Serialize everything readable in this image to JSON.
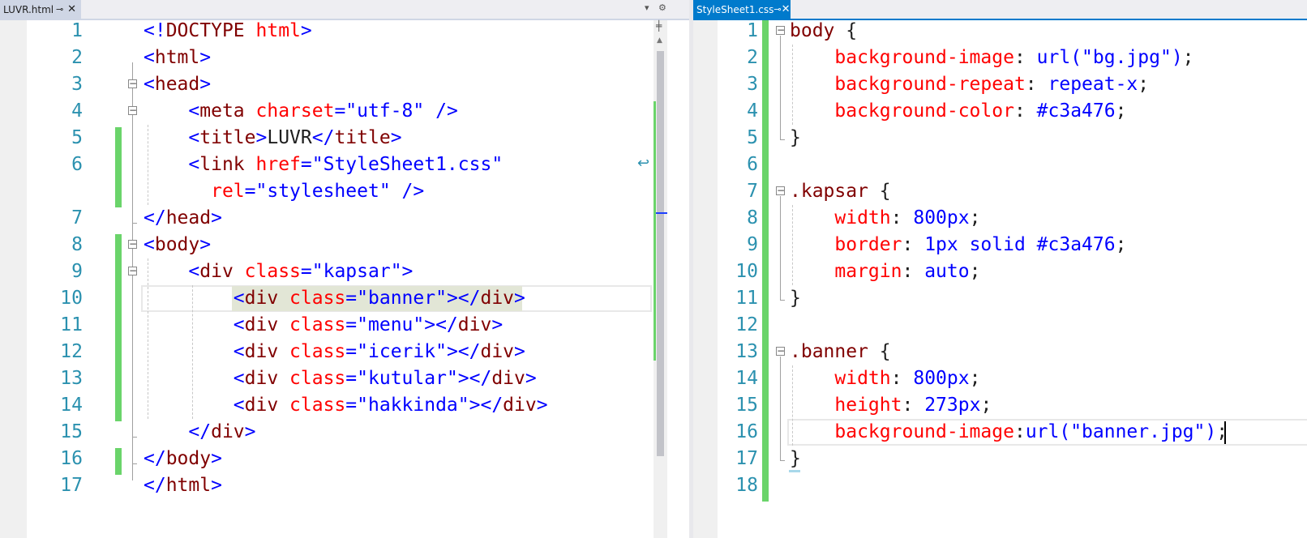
{
  "left_tab": {
    "title": "LUVR.html",
    "pin": "⊸",
    "close": "✕"
  },
  "right_tab": {
    "title": "StyleSheet1.css",
    "pin": "⊸",
    "close": "✕"
  },
  "strip_icons": {
    "dropdown": "▾",
    "settings": "⚙"
  },
  "html_lines": [
    {
      "num": "1",
      "segs": [
        [
          "p",
          "<!"
        ],
        [
          "t",
          "DOCTYPE"
        ],
        [
          "s",
          " "
        ],
        [
          "a",
          "html"
        ],
        [
          "p",
          ">"
        ]
      ]
    },
    {
      "num": "2",
      "segs": [
        [
          "p",
          "<"
        ],
        [
          "t",
          "html"
        ],
        [
          "p",
          ">"
        ]
      ]
    },
    {
      "num": "3",
      "segs": [
        [
          "p",
          "<"
        ],
        [
          "t",
          "head"
        ],
        [
          "p",
          ">"
        ]
      ]
    },
    {
      "num": "4",
      "segs": [
        [
          "s",
          "    "
        ],
        [
          "p",
          "<"
        ],
        [
          "t",
          "meta"
        ],
        [
          "s",
          " "
        ],
        [
          "a",
          "charset"
        ],
        [
          "p",
          "=\""
        ],
        [
          "v",
          "utf-8"
        ],
        [
          "p",
          "\""
        ],
        [
          "s",
          " "
        ],
        [
          "p",
          "/>"
        ]
      ]
    },
    {
      "num": "5",
      "segs": [
        [
          "s",
          "    "
        ],
        [
          "p",
          "<"
        ],
        [
          "t",
          "title"
        ],
        [
          "p",
          ">"
        ],
        [
          "s",
          "LUVR"
        ],
        [
          "p",
          "</"
        ],
        [
          "t",
          "title"
        ],
        [
          "p",
          ">"
        ]
      ]
    },
    {
      "num": "6",
      "segs": [
        [
          "s",
          "    "
        ],
        [
          "p",
          "<"
        ],
        [
          "t",
          "link"
        ],
        [
          "s",
          " "
        ],
        [
          "a",
          "href"
        ],
        [
          "p",
          "=\""
        ],
        [
          "v",
          "StyleSheet1.css"
        ],
        [
          "p",
          "\""
        ]
      ]
    },
    {
      "num": "",
      "segs": [
        [
          "s",
          "      "
        ],
        [
          "a",
          "rel"
        ],
        [
          "p",
          "=\""
        ],
        [
          "v",
          "stylesheet"
        ],
        [
          "p",
          "\""
        ],
        [
          "s",
          " "
        ],
        [
          "p",
          "/>"
        ]
      ]
    },
    {
      "num": "7",
      "segs": [
        [
          "p",
          "</"
        ],
        [
          "t",
          "head"
        ],
        [
          "p",
          ">"
        ]
      ]
    },
    {
      "num": "8",
      "segs": [
        [
          "p",
          "<"
        ],
        [
          "t",
          "body"
        ],
        [
          "p",
          ">"
        ]
      ]
    },
    {
      "num": "9",
      "segs": [
        [
          "s",
          "    "
        ],
        [
          "p",
          "<"
        ],
        [
          "t",
          "div"
        ],
        [
          "s",
          " "
        ],
        [
          "a",
          "class"
        ],
        [
          "p",
          "=\""
        ],
        [
          "v",
          "kapsar"
        ],
        [
          "p",
          "\">"
        ]
      ]
    },
    {
      "num": "10",
      "segs": [
        [
          "s",
          "        "
        ],
        [
          "p",
          "<"
        ],
        [
          "t",
          "div"
        ],
        [
          "s",
          " "
        ],
        [
          "a",
          "class"
        ],
        [
          "p",
          "=\""
        ],
        [
          "v",
          "banner"
        ],
        [
          "p",
          "\"></"
        ],
        [
          "t",
          "div"
        ],
        [
          "p",
          ">"
        ]
      ]
    },
    {
      "num": "11",
      "segs": [
        [
          "s",
          "        "
        ],
        [
          "p",
          "<"
        ],
        [
          "t",
          "div"
        ],
        [
          "s",
          " "
        ],
        [
          "a",
          "class"
        ],
        [
          "p",
          "=\""
        ],
        [
          "v",
          "menu"
        ],
        [
          "p",
          "\"></"
        ],
        [
          "t",
          "div"
        ],
        [
          "p",
          ">"
        ]
      ]
    },
    {
      "num": "12",
      "segs": [
        [
          "s",
          "        "
        ],
        [
          "p",
          "<"
        ],
        [
          "t",
          "div"
        ],
        [
          "s",
          " "
        ],
        [
          "a",
          "class"
        ],
        [
          "p",
          "=\""
        ],
        [
          "v",
          "icerik"
        ],
        [
          "p",
          "\"></"
        ],
        [
          "t",
          "div"
        ],
        [
          "p",
          ">"
        ]
      ]
    },
    {
      "num": "13",
      "segs": [
        [
          "s",
          "        "
        ],
        [
          "p",
          "<"
        ],
        [
          "t",
          "div"
        ],
        [
          "s",
          " "
        ],
        [
          "a",
          "class"
        ],
        [
          "p",
          "=\""
        ],
        [
          "v",
          "kutular"
        ],
        [
          "p",
          "\"></"
        ],
        [
          "t",
          "div"
        ],
        [
          "p",
          ">"
        ]
      ]
    },
    {
      "num": "14",
      "segs": [
        [
          "s",
          "        "
        ],
        [
          "p",
          "<"
        ],
        [
          "t",
          "div"
        ],
        [
          "s",
          " "
        ],
        [
          "a",
          "class"
        ],
        [
          "p",
          "=\""
        ],
        [
          "v",
          "hakkinda"
        ],
        [
          "p",
          "\"></"
        ],
        [
          "t",
          "div"
        ],
        [
          "p",
          ">"
        ]
      ]
    },
    {
      "num": "15",
      "segs": [
        [
          "s",
          "    "
        ],
        [
          "p",
          "</"
        ],
        [
          "t",
          "div"
        ],
        [
          "p",
          ">"
        ]
      ]
    },
    {
      "num": "16",
      "segs": [
        [
          "p",
          "</"
        ],
        [
          "t",
          "body"
        ],
        [
          "p",
          ">"
        ]
      ]
    },
    {
      "num": "17",
      "segs": [
        [
          "p",
          "</"
        ],
        [
          "t",
          "html"
        ],
        [
          "p",
          ">"
        ]
      ]
    }
  ],
  "css_lines": [
    {
      "num": "1",
      "segs": [
        [
          "t",
          "body"
        ],
        [
          "s",
          " {"
        ]
      ]
    },
    {
      "num": "2",
      "segs": [
        [
          "s",
          "    "
        ],
        [
          "a",
          "background-image"
        ],
        [
          "s",
          ": "
        ],
        [
          "v",
          "url(\"bg.jpg\")"
        ],
        [
          "s",
          ";"
        ]
      ]
    },
    {
      "num": "3",
      "segs": [
        [
          "s",
          "    "
        ],
        [
          "a",
          "background-repeat"
        ],
        [
          "s",
          ": "
        ],
        [
          "v",
          "repeat-x"
        ],
        [
          "s",
          ";"
        ]
      ]
    },
    {
      "num": "4",
      "segs": [
        [
          "s",
          "    "
        ],
        [
          "a",
          "background-color"
        ],
        [
          "s",
          ": "
        ],
        [
          "v",
          "#c3a476"
        ],
        [
          "s",
          ";"
        ]
      ]
    },
    {
      "num": "5",
      "segs": [
        [
          "s",
          "}"
        ]
      ]
    },
    {
      "num": "6",
      "segs": []
    },
    {
      "num": "7",
      "segs": [
        [
          "t",
          ".kapsar"
        ],
        [
          "s",
          " {"
        ]
      ]
    },
    {
      "num": "8",
      "segs": [
        [
          "s",
          "    "
        ],
        [
          "a",
          "width"
        ],
        [
          "s",
          ": "
        ],
        [
          "v",
          "800px"
        ],
        [
          "s",
          ";"
        ]
      ]
    },
    {
      "num": "9",
      "segs": [
        [
          "s",
          "    "
        ],
        [
          "a",
          "border"
        ],
        [
          "s",
          ": "
        ],
        [
          "v",
          "1px solid #c3a476"
        ],
        [
          "s",
          ";"
        ]
      ]
    },
    {
      "num": "10",
      "segs": [
        [
          "s",
          "    "
        ],
        [
          "a",
          "margin"
        ],
        [
          "s",
          ": "
        ],
        [
          "v",
          "auto"
        ],
        [
          "s",
          ";"
        ]
      ]
    },
    {
      "num": "11",
      "segs": [
        [
          "s",
          "}"
        ]
      ]
    },
    {
      "num": "12",
      "segs": []
    },
    {
      "num": "13",
      "segs": [
        [
          "t",
          ".banner"
        ],
        [
          "s",
          " {"
        ]
      ]
    },
    {
      "num": "14",
      "segs": [
        [
          "s",
          "    "
        ],
        [
          "a",
          "width"
        ],
        [
          "s",
          ": "
        ],
        [
          "v",
          "800px"
        ],
        [
          "s",
          ";"
        ]
      ]
    },
    {
      "num": "15",
      "segs": [
        [
          "s",
          "    "
        ],
        [
          "a",
          "height"
        ],
        [
          "s",
          ": "
        ],
        [
          "v",
          "273px"
        ],
        [
          "s",
          ";"
        ]
      ]
    },
    {
      "num": "16",
      "segs": [
        [
          "s",
          "    "
        ],
        [
          "a",
          "background-image"
        ],
        [
          "s",
          ":"
        ],
        [
          "v",
          "url(\"banner.jpg\")"
        ],
        [
          "s",
          ";"
        ]
      ]
    },
    {
      "num": "17",
      "segs": [
        [
          "s",
          "}"
        ]
      ]
    },
    {
      "num": "18",
      "segs": []
    }
  ]
}
